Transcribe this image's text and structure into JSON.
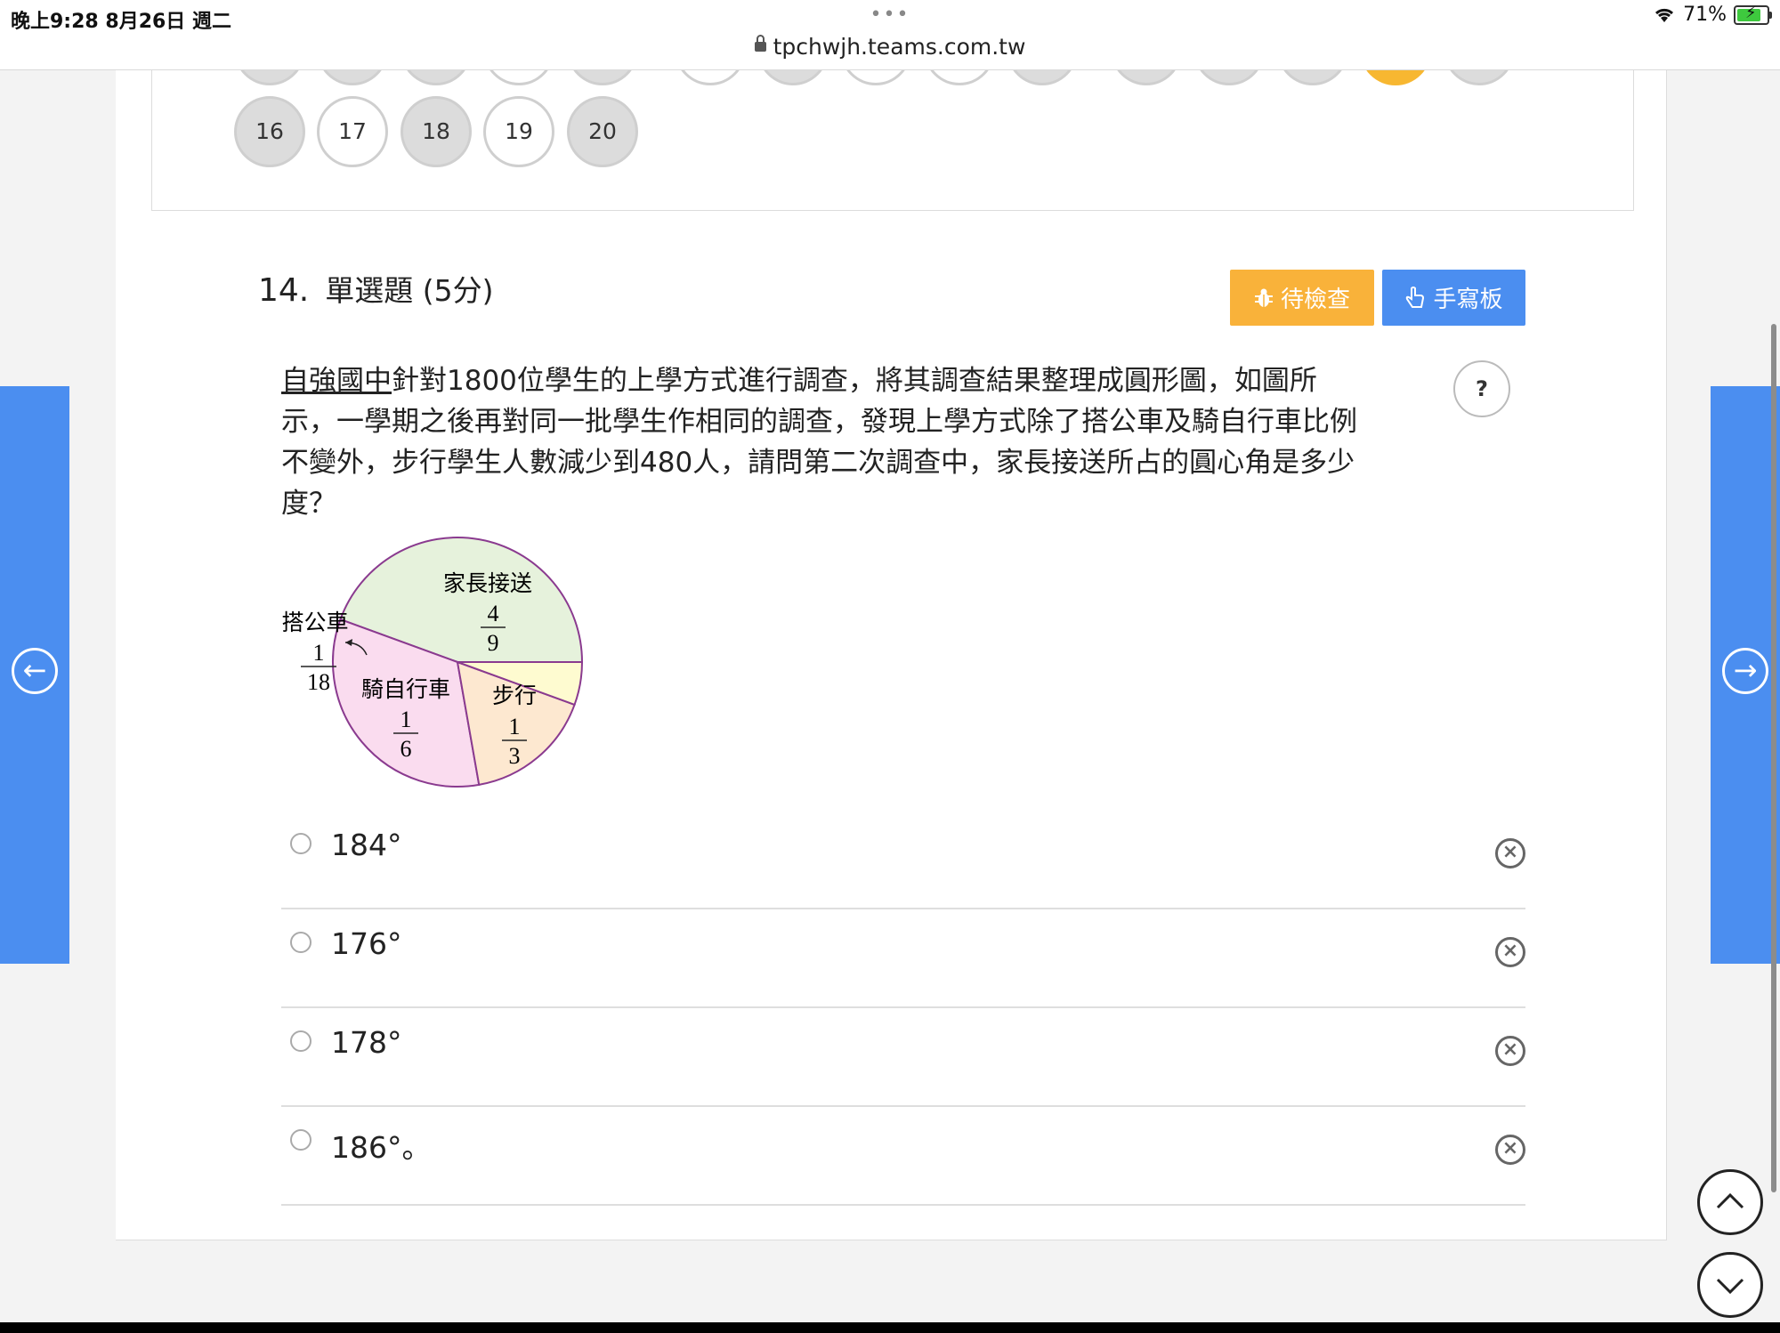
{
  "status": {
    "time": "晚上9:28   8月26日 週二",
    "dots": "•••",
    "url": "tpchwjh.teams.com.tw",
    "battery": "71%"
  },
  "question_nav": {
    "bottom_row": [
      {
        "label": "16",
        "answered": true
      },
      {
        "label": "17",
        "answered": false
      },
      {
        "label": "18",
        "answered": true
      },
      {
        "label": "19",
        "answered": false
      },
      {
        "label": "20",
        "answered": true
      }
    ]
  },
  "question": {
    "number": "14.",
    "type": "單選題 (5分)",
    "pending_label": "待檢查",
    "handwriting_label": "手寫板",
    "help_label": "?",
    "school": "自強國中",
    "text_line1": "針對1800位學生的上學方式進行調查，將其調查結果整理成圓形圖，如圖所",
    "text_line2": "示，一學期之後再對同一批學生作相同的調查，發現上學方式除了搭公車及騎自行車比例",
    "text_line3": "不變外，步行學生人數減少到480人，請問第二次調查中，家長接送所占的圓心角是多少",
    "text_line4": "度？"
  },
  "pie": {
    "slices": [
      {
        "name": "家長接送",
        "num": "4",
        "den": "9",
        "fraction": 0.4444,
        "color": "#e6f2dc"
      },
      {
        "name": "步行",
        "num": "1",
        "den": "3",
        "fraction": 0.3333,
        "color": "#fadcef"
      },
      {
        "name": "騎自行車",
        "num": "1",
        "den": "6",
        "fraction": 0.1667,
        "color": "#fde8d0"
      },
      {
        "name": "搭公車",
        "num": "1",
        "den": "18",
        "fraction": 0.0556,
        "color": "#fefbd0"
      }
    ],
    "stroke_color": "#8a3a8f"
  },
  "options": [
    {
      "label": "184°"
    },
    {
      "label": "176°"
    },
    {
      "label": "178°"
    },
    {
      "label": "186°。"
    }
  ],
  "colors": {
    "accent_blue": "#4b8ef0",
    "accent_orange": "#f9b23a"
  }
}
